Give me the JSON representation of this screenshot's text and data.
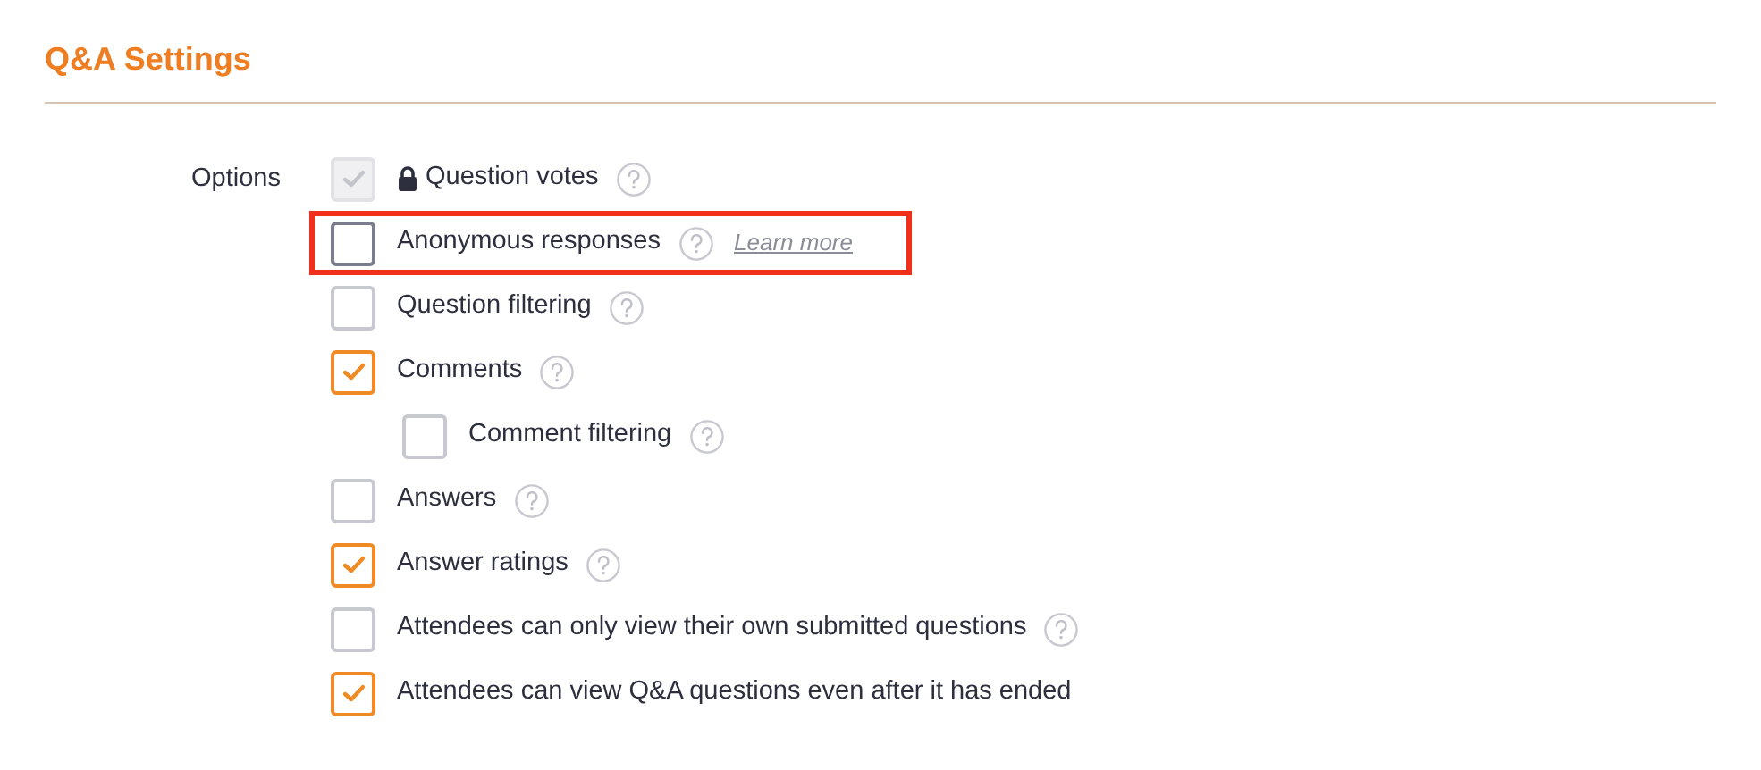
{
  "section": {
    "title": "Q&A Settings"
  },
  "options": {
    "label": "Options",
    "items": [
      {
        "label": "Question votes",
        "checked": true,
        "disabled": true,
        "locked": true,
        "help": true,
        "highlighted": false
      },
      {
        "label": "Anonymous responses",
        "checked": false,
        "disabled": false,
        "locked": false,
        "help": true,
        "link": "Learn more",
        "highlighted": true
      },
      {
        "label": "Question filtering",
        "checked": false,
        "disabled": false,
        "locked": false,
        "help": true,
        "highlighted": false
      },
      {
        "label": "Comments",
        "checked": true,
        "disabled": false,
        "locked": false,
        "help": true,
        "highlighted": false,
        "children": [
          {
            "label": "Comment filtering",
            "checked": false,
            "disabled": false,
            "locked": false,
            "help": true,
            "highlighted": false
          }
        ]
      },
      {
        "label": "Answers",
        "checked": false,
        "disabled": false,
        "locked": false,
        "help": true,
        "highlighted": false
      },
      {
        "label": "Answer ratings",
        "checked": true,
        "disabled": false,
        "locked": false,
        "help": true,
        "highlighted": false
      },
      {
        "label": "Attendees can only view their own submitted questions",
        "checked": false,
        "disabled": false,
        "locked": false,
        "help": true,
        "highlighted": false
      },
      {
        "label": "Attendees can view Q&A questions even after it has ended",
        "checked": true,
        "disabled": false,
        "locked": false,
        "help": false,
        "highlighted": false
      }
    ]
  }
}
